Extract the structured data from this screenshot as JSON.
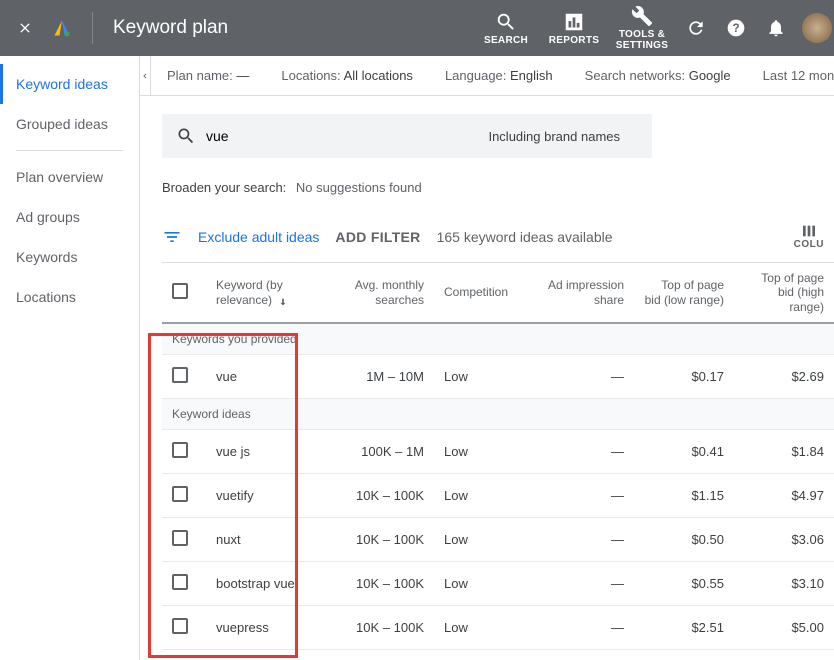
{
  "header": {
    "title": "Keyword plan",
    "actions": [
      {
        "label": "SEARCH",
        "icon": "search"
      },
      {
        "label": "REPORTS",
        "icon": "chart"
      },
      {
        "label": "TOOLS & SETTINGS",
        "icon": "wrench"
      }
    ]
  },
  "sidebar": {
    "groups": [
      [
        {
          "label": "Keyword ideas",
          "active": true
        },
        {
          "label": "Grouped ideas",
          "active": false
        }
      ],
      [
        {
          "label": "Plan overview",
          "active": false
        },
        {
          "label": "Ad groups",
          "active": false
        },
        {
          "label": "Keywords",
          "active": false
        },
        {
          "label": "Locations",
          "active": false
        }
      ]
    ]
  },
  "breadcrumb": {
    "plan_name_label": "Plan name:",
    "plan_name_value": "—",
    "locations_label": "Locations:",
    "locations_value": "All locations",
    "language_label": "Language:",
    "language_value": "English",
    "networks_label": "Search networks:",
    "networks_value": "Google",
    "daterange": "Last 12 mon"
  },
  "search": {
    "value": "vue",
    "brand_toggle": "Including brand names"
  },
  "broaden": {
    "label": "Broaden your search:",
    "message": "No suggestions found"
  },
  "filters": {
    "exclude": "Exclude adult ideas",
    "add": "ADD FILTER",
    "count": "165 keyword ideas available",
    "columns": "COLU"
  },
  "table": {
    "headers": {
      "keyword": "Keyword (by relevance)",
      "searches": "Avg. monthly searches",
      "competition": "Competition",
      "impression": "Ad impression share",
      "low_bid": "Top of page bid (low range)",
      "high_bid": "Top of page bid (high range)"
    },
    "section_provided": "Keywords you provided",
    "section_ideas": "Keyword ideas",
    "rows_provided": [
      {
        "kw": "vue",
        "searches": "1M – 10M",
        "comp": "Low",
        "imp": "—",
        "low": "$0.17",
        "high": "$2.69"
      }
    ],
    "rows_ideas": [
      {
        "kw": "vue js",
        "searches": "100K – 1M",
        "comp": "Low",
        "imp": "—",
        "low": "$0.41",
        "high": "$1.84"
      },
      {
        "kw": "vuetify",
        "searches": "10K – 100K",
        "comp": "Low",
        "imp": "—",
        "low": "$1.15",
        "high": "$4.97"
      },
      {
        "kw": "nuxt",
        "searches": "10K – 100K",
        "comp": "Low",
        "imp": "—",
        "low": "$0.50",
        "high": "$3.06"
      },
      {
        "kw": "bootstrap vue",
        "searches": "10K – 100K",
        "comp": "Low",
        "imp": "—",
        "low": "$0.55",
        "high": "$3.10"
      },
      {
        "kw": "vuepress",
        "searches": "10K – 100K",
        "comp": "Low",
        "imp": "—",
        "low": "$2.51",
        "high": "$5.00"
      }
    ]
  }
}
